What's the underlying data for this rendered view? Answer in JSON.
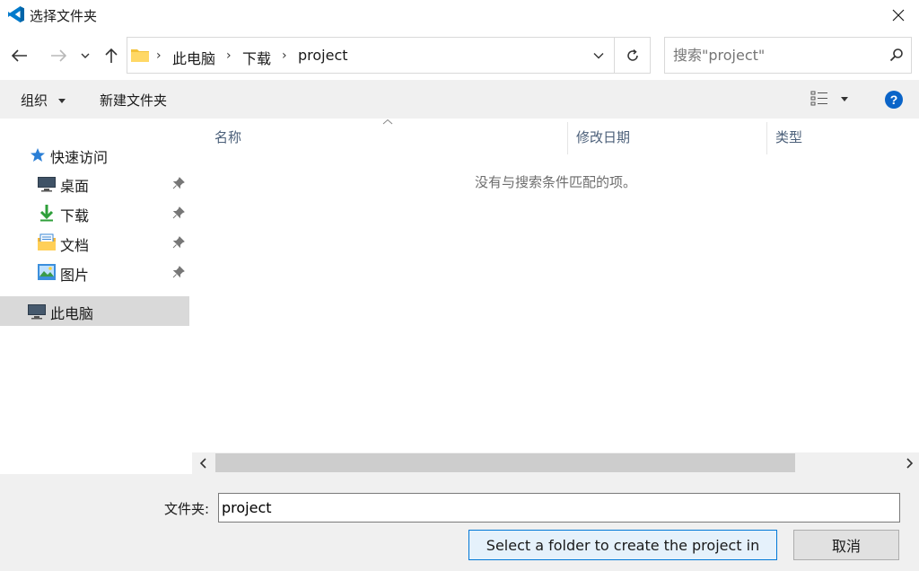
{
  "window": {
    "title": "选择文件夹",
    "icon": "vscode-icon"
  },
  "address": {
    "crumbs": [
      "此电脑",
      "下载",
      "project"
    ]
  },
  "search": {
    "placeholder": "搜索\"project\""
  },
  "toolbar": {
    "organize": "组织",
    "new_folder": "新建文件夹"
  },
  "sidebar": {
    "quick_access": "快速访问",
    "items": [
      {
        "label": "桌面",
        "icon": "desktop-icon"
      },
      {
        "label": "下载",
        "icon": "download-icon"
      },
      {
        "label": "文档",
        "icon": "documents-icon"
      },
      {
        "label": "图片",
        "icon": "pictures-icon"
      }
    ],
    "this_pc": "此电脑"
  },
  "list": {
    "columns": [
      "名称",
      "修改日期",
      "类型"
    ],
    "empty_message": "没有与搜索条件匹配的项。"
  },
  "footer": {
    "folder_label": "文件夹:",
    "folder_value": "project",
    "primary_button": "Select a folder to create the project in",
    "cancel_button": "取消"
  },
  "colors": {
    "accent": "#0078d7",
    "selected_bg": "#d9d9d9",
    "bar_bg": "#f0f0f0"
  }
}
